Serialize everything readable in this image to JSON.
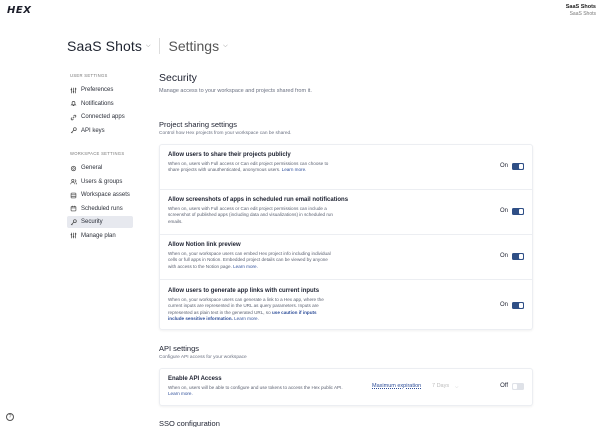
{
  "app": {
    "logo": "HEX",
    "workspace_name": "SaaS Shots",
    "workspace_sub": "SaaS Shots"
  },
  "header": {
    "project": "SaaS Shots",
    "section": "Settings"
  },
  "sidebar": {
    "user_heading": "USER SETTINGS",
    "user_items": [
      {
        "label": "Preferences",
        "icon": "sliders-icon"
      },
      {
        "label": "Notifications",
        "icon": "bell-icon"
      },
      {
        "label": "Connected apps",
        "icon": "link-icon"
      },
      {
        "label": "API keys",
        "icon": "key-icon"
      }
    ],
    "workspace_heading": "WORKSPACE SETTINGS",
    "workspace_items": [
      {
        "label": "General",
        "icon": "gear-icon"
      },
      {
        "label": "Users & groups",
        "icon": "users-icon"
      },
      {
        "label": "Workspace assets",
        "icon": "database-icon"
      },
      {
        "label": "Scheduled runs",
        "icon": "calendar-icon"
      },
      {
        "label": "Security",
        "icon": "key-icon",
        "active": true
      },
      {
        "label": "Manage plan",
        "icon": "sliders-icon"
      }
    ]
  },
  "main": {
    "title": "Security",
    "subtitle": "Manage access to your workspace and projects shared from it.",
    "project_sharing": {
      "title": "Project sharing settings",
      "subtitle": "Control how Hex projects from your workspace can be shared.",
      "rows": [
        {
          "title": "Allow users to share their projects publicly",
          "desc": "When on, users with Full access or Can edit project permissions can choose to share projects with unauthenticated, anonymous users.",
          "link": "Learn more.",
          "state": "On"
        },
        {
          "title": "Allow screenshots of apps in scheduled run email notifications",
          "desc": "When on, users with Full access or Can edit project permissions can include a screenshot of published apps (including data and visualizations) in scheduled run emails.",
          "link": "",
          "state": "On"
        },
        {
          "title": "Allow Notion link preview",
          "desc": "When on, your workspace users can embed Hex project info including individual cells or full apps in Notion. Embedded project details can be viewed by anyone with access to the Notion page.",
          "link": "Learn more.",
          "state": "On"
        },
        {
          "title": "Allow users to generate app links with current inputs",
          "desc": "When on, your workspace users can generate a link to a Hex app, where the current inputs are represented in the URL as query parameters. Inputs are represented as plain text in the generated URL, so",
          "emph": "use caution if inputs include sensitive information.",
          "link": "Learn more.",
          "state": "On"
        }
      ]
    },
    "api": {
      "title": "API settings",
      "subtitle": "Configure API access for your workspace",
      "row": {
        "title": "Enable API Access",
        "desc": "When on, users will be able to configure and use tokens to access the Hex public API.",
        "link": "Learn more.",
        "max_label": "Maximum expiration",
        "max_value": "7 Days",
        "state": "Off"
      }
    },
    "sso": {
      "title": "SSO configuration"
    }
  },
  "colors": {
    "accent": "#2f4f86",
    "link": "#2f4f9a",
    "active_bg": "#e7e9ef"
  }
}
